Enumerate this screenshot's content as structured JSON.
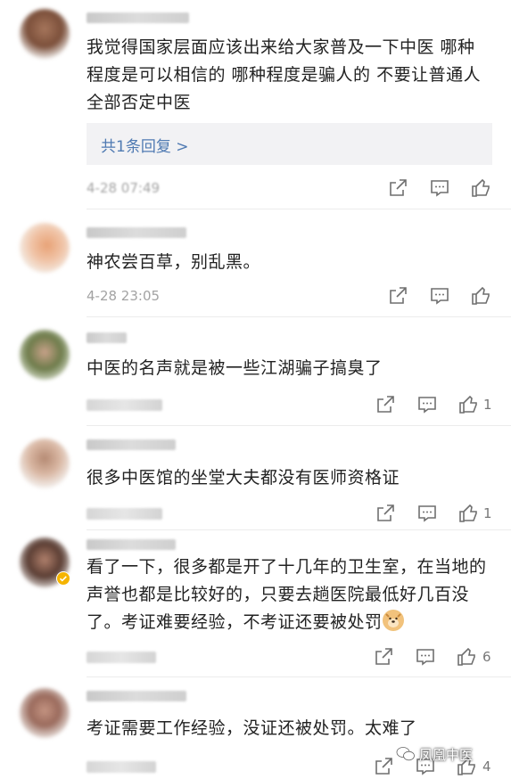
{
  "comments": [
    {
      "text": "我觉得国家层面应该出来给大家普及一下中医 哪种程度是可以相信的 哪种程度是骗人的 不要让普通人全部否定中医",
      "reply_link": "共1条回复 >",
      "time": "4-28 07:49",
      "likes": ""
    },
    {
      "text": "神农尝百草，别乱黑。",
      "time": "4-28 23:05",
      "likes": ""
    },
    {
      "text": "中医的名声就是被一些江湖骗子搞臭了",
      "time": "",
      "likes": "1"
    },
    {
      "text": "很多中医馆的坐堂大夫都没有医师资格证",
      "time": "",
      "likes": "1"
    },
    {
      "text": "看了一下，很多都是开了十几年的卫生室，在当地的声誉也都是比较好的，只要去趟医院最低好几百没了。考证难要经验，不考证还要被处罚",
      "time": "",
      "likes": "6"
    },
    {
      "text": "考证需要工作经验，没证还被处罚。太难了",
      "time": "",
      "likes": "4"
    }
  ],
  "watermark": "凤凰中医",
  "colors": {
    "reply_link": "#4f7ab2",
    "reply_bg": "#f2f2f4",
    "meta": "#a3a3a3",
    "verified_badge": "#f5b400"
  },
  "icons": {
    "share": "share-icon",
    "reply": "comment-icon",
    "like": "thumbs-up-icon"
  }
}
